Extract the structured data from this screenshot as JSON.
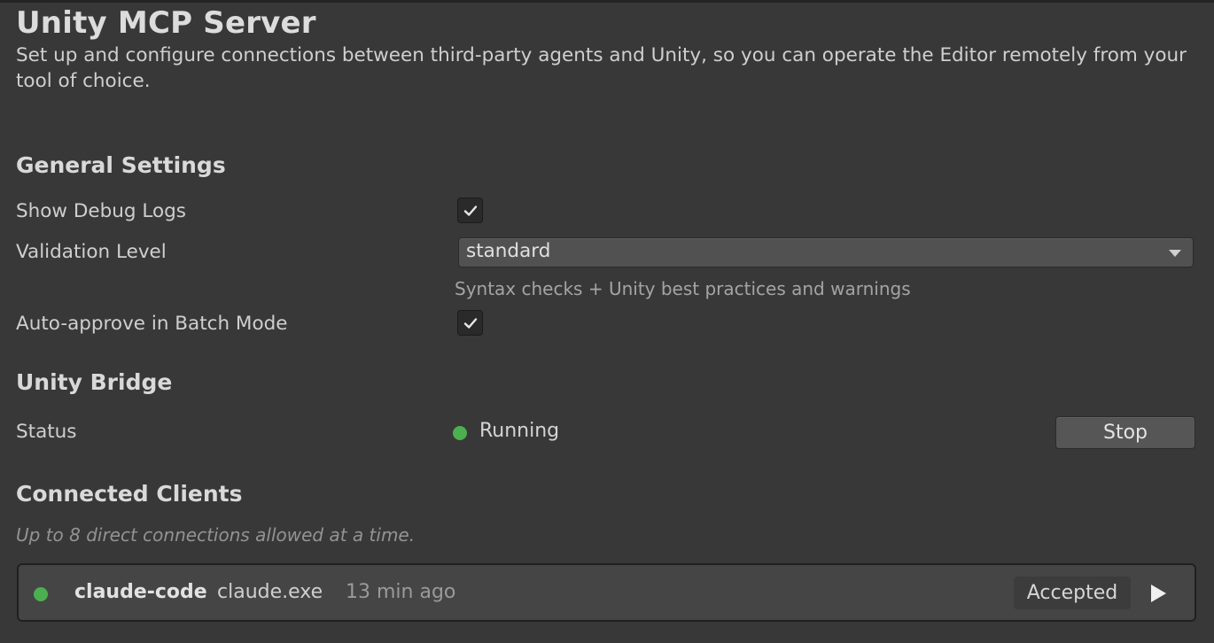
{
  "header": {
    "title": "Unity MCP Server",
    "subtitle": "Set up and configure connections between third-party agents and Unity, so you can operate the Editor remotely from your tool of choice."
  },
  "general_settings": {
    "heading": "General Settings",
    "show_debug_logs": {
      "label": "Show Debug Logs",
      "checked": true
    },
    "validation_level": {
      "label": "Validation Level",
      "value": "standard",
      "hint": "Syntax checks + Unity best practices and warnings"
    },
    "auto_approve": {
      "label": "Auto-approve in Batch Mode",
      "checked": true
    }
  },
  "unity_bridge": {
    "heading": "Unity Bridge",
    "status_label": "Status",
    "status_value": "Running",
    "status_color": "#4caf50",
    "stop_label": "Stop"
  },
  "connected_clients": {
    "heading": "Connected Clients",
    "note": "Up to 8 direct connections allowed at a time.",
    "clients": [
      {
        "name": "claude-code",
        "exe": "claude.exe",
        "time": "13 min ago",
        "state": "Accepted",
        "status_color": "#4caf50",
        "action_icon": "play-icon"
      }
    ]
  }
}
